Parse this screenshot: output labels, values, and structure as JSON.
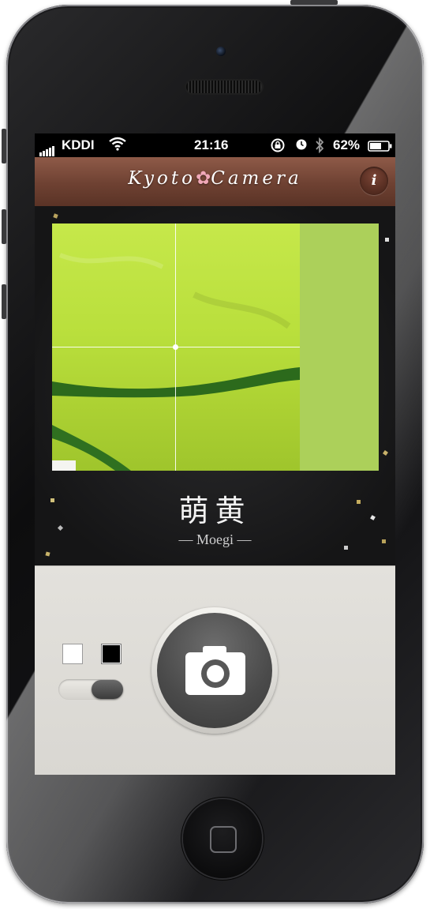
{
  "status_bar": {
    "carrier": "KDDI",
    "time": "21:16",
    "battery": "62%",
    "battery_level": 0.62,
    "icons": [
      "signal-bars-icon",
      "wifi-icon",
      "rotation-lock-icon",
      "alarm-icon",
      "bluetooth-icon",
      "battery-icon"
    ]
  },
  "nav": {
    "title_left": "Kyoto",
    "title_flower": "✿",
    "title_right": "Camera",
    "info_label": "i"
  },
  "color": {
    "name_jp": "萌黄",
    "name_romaji": "— Moegi —",
    "swatch_hex": "#acd05a"
  },
  "controls": {
    "white_swatch": "#ffffff",
    "black_swatch": "#000000",
    "toggle_on": true,
    "shutter_icon": "camera-icon"
  },
  "colors": {
    "nav_brown": "#6e4132",
    "bottom_panel": "#dedcd7"
  }
}
